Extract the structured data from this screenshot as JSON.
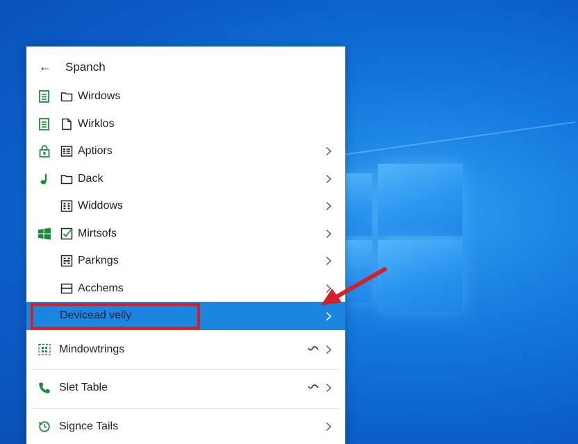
{
  "header": {
    "title": "Spanch"
  },
  "menu": {
    "items": [
      {
        "label": "Wirdows",
        "lead_icon": "document-icon",
        "item_icon": "folder-icon",
        "has_chevron": false
      },
      {
        "label": "Wirklos",
        "lead_icon": "document-icon",
        "item_icon": "file-icon",
        "has_chevron": false
      },
      {
        "label": "Aptiors",
        "lead_icon": "lock-icon",
        "item_icon": "list-icon",
        "has_chevron": true
      },
      {
        "label": "Dack",
        "lead_icon": "music-note-icon",
        "item_icon": "folder-icon",
        "has_chevron": true
      },
      {
        "label": "Widdows",
        "lead_icon": "",
        "item_icon": "keypad-icon",
        "has_chevron": true
      },
      {
        "label": "Mirtsofs",
        "lead_icon": "windows-logo-icon",
        "item_icon": "checkbox-icon",
        "has_chevron": true
      },
      {
        "label": "Parkngs",
        "lead_icon": "",
        "item_icon": "keypad-icon",
        "has_chevron": true
      },
      {
        "label": "Acchems",
        "lead_icon": "",
        "item_icon": "minus-box-icon",
        "has_chevron": true
      }
    ],
    "active_item": {
      "label": "Devicead velly",
      "has_chevron": true
    }
  },
  "sections": [
    {
      "label": "Mindowtrings",
      "icon": "grid-dots-icon",
      "aux_icon": "wave-icon"
    },
    {
      "label": "Slet Table",
      "icon": "phone-icon",
      "aux_icon": "wave-icon"
    },
    {
      "label": "Signce Tails",
      "icon": "refresh-clock-icon",
      "aux_icon": ""
    }
  ],
  "colors": {
    "desktop": "#1378de",
    "highlight": "#1a86e0",
    "annotation": "#d42028",
    "icon_green": "#1c8a3c"
  }
}
